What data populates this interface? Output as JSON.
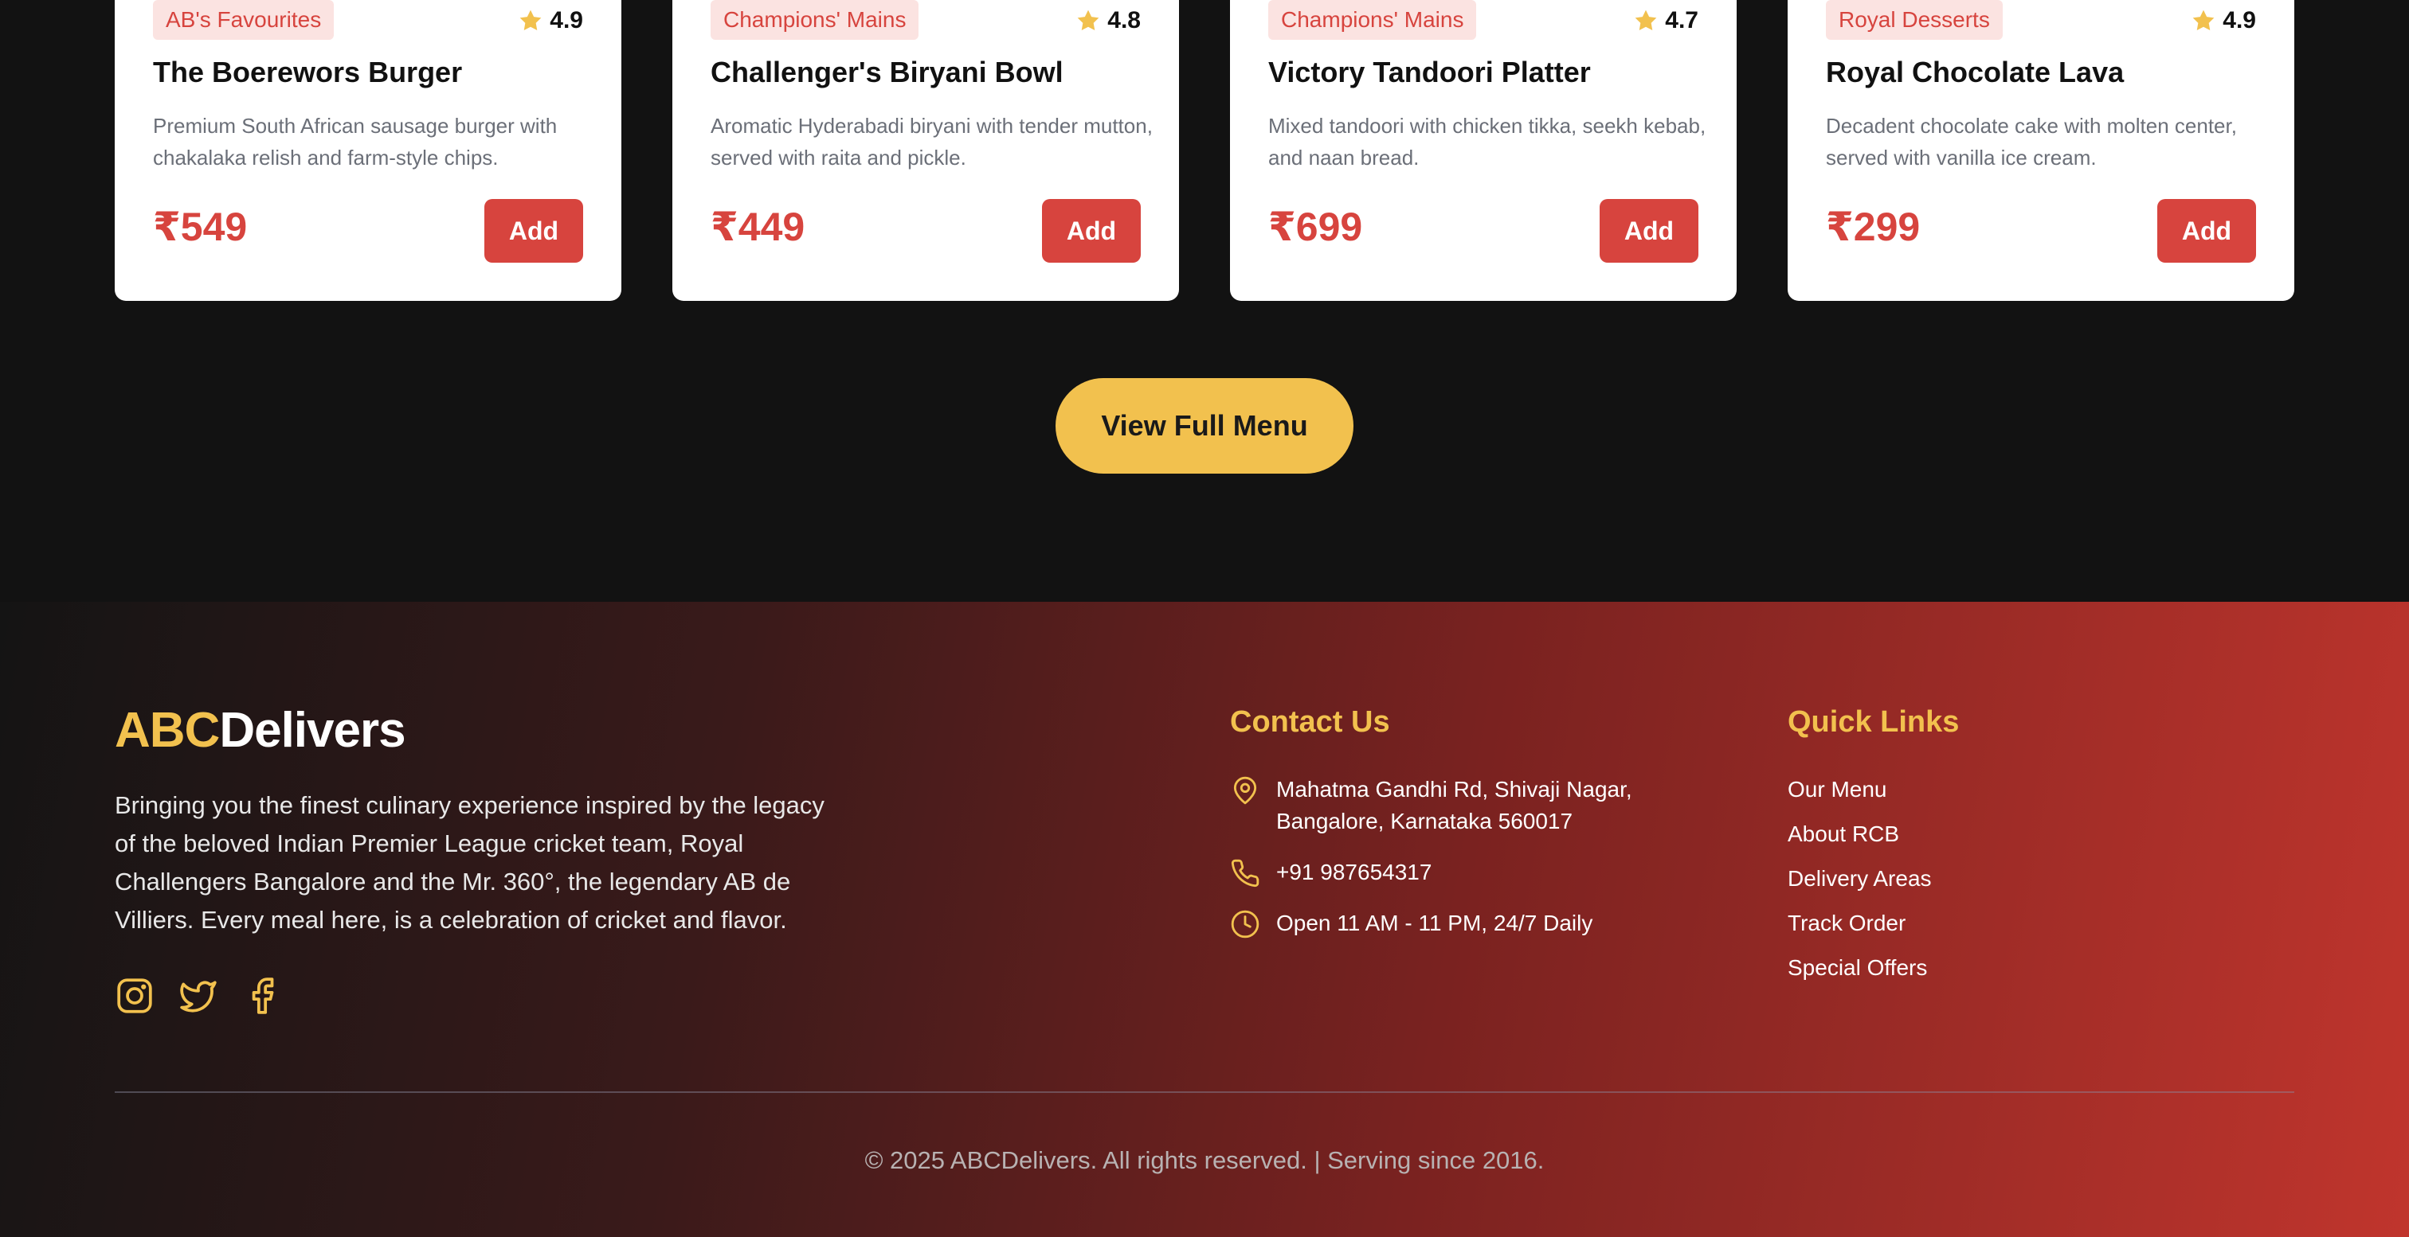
{
  "menu": {
    "cards": [
      {
        "category": "AB's Favourites",
        "rating": "4.9",
        "name": "The Boerewors Burger",
        "description": "Premium South African sausage burger with chakalaka relish and farm-style chips.",
        "price": "₹549",
        "add_label": "Add"
      },
      {
        "category": "Champions' Mains",
        "rating": "4.8",
        "name": "Challenger's Biryani Bowl",
        "description": "Aromatic Hyderabadi biryani with tender mutton, served with raita and pickle.",
        "price": "₹449",
        "add_label": "Add"
      },
      {
        "category": "Champions' Mains",
        "rating": "4.7",
        "name": "Victory Tandoori Platter",
        "description": "Mixed tandoori with chicken tikka, seekh kebab, and naan bread.",
        "price": "₹699",
        "add_label": "Add"
      },
      {
        "category": "Royal Desserts",
        "rating": "4.9",
        "name": "Royal Chocolate Lava",
        "description": "Decadent chocolate cake with molten center, served with vanilla ice cream.",
        "price": "₹299",
        "add_label": "Add"
      }
    ],
    "view_full_menu_label": "View Full Menu"
  },
  "footer": {
    "brand_highlight": "ABC",
    "brand_rest": "Delivers",
    "about": "Bringing you the finest culinary experience inspired by the legacy of the beloved Indian Premier League cricket team, Royal Challengers Bangalore and the Mr. 360°, the legendary AB de Villiers. Every meal here, is a celebration of cricket and flavor.",
    "socials": [
      "instagram-icon",
      "twitter-icon",
      "facebook-icon"
    ],
    "contact": {
      "title": "Contact Us",
      "address": "Mahatma Gandhi Rd, Shivaji Nagar, Bangalore, Karnataka 560017",
      "phone": "+91 987654317",
      "hours": "Open 11 AM - 11 PM, 24/7 Daily"
    },
    "quick_links": {
      "title": "Quick Links",
      "items": [
        "Our Menu",
        "About RCB",
        "Delivery Areas",
        "Track Order",
        "Special Offers"
      ]
    },
    "copyright": "© 2025 ABCDelivers. All rights reserved. | Serving since 2016."
  },
  "colors": {
    "accent_red": "#d7443e",
    "accent_gold": "#f2c14e",
    "background_dark": "#121212",
    "badge_bg": "#fbe3e1"
  }
}
